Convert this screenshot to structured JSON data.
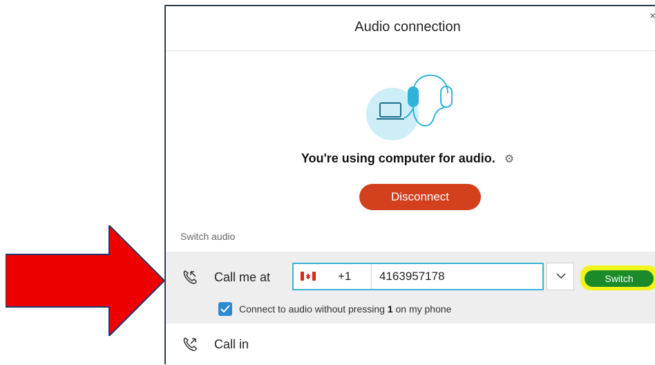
{
  "dialog": {
    "title": "Audio connection",
    "close_glyph": "×",
    "status_text": "You're using computer for audio.",
    "settings_icon": "gear-icon",
    "disconnect_label": "Disconnect",
    "section_label": "Switch audio"
  },
  "call_me": {
    "label": "Call me at",
    "country_code": "+1",
    "country_flag": "canada-flag-icon",
    "phone_number": "4163957178",
    "switch_label": "Switch",
    "checkbox_checked": true,
    "checkbox_text_before": "Connect to audio without pressing ",
    "checkbox_text_bold": "1",
    "checkbox_text_after": " on my phone"
  },
  "call_in": {
    "label": "Call in"
  },
  "colors": {
    "disconnect": "#d2401e",
    "switch": "#1a8a2a",
    "highlight": "#f2f51b",
    "input_focus": "#35b4d8",
    "checkbox": "#2d8ad1",
    "arrow": "#ee0000"
  }
}
